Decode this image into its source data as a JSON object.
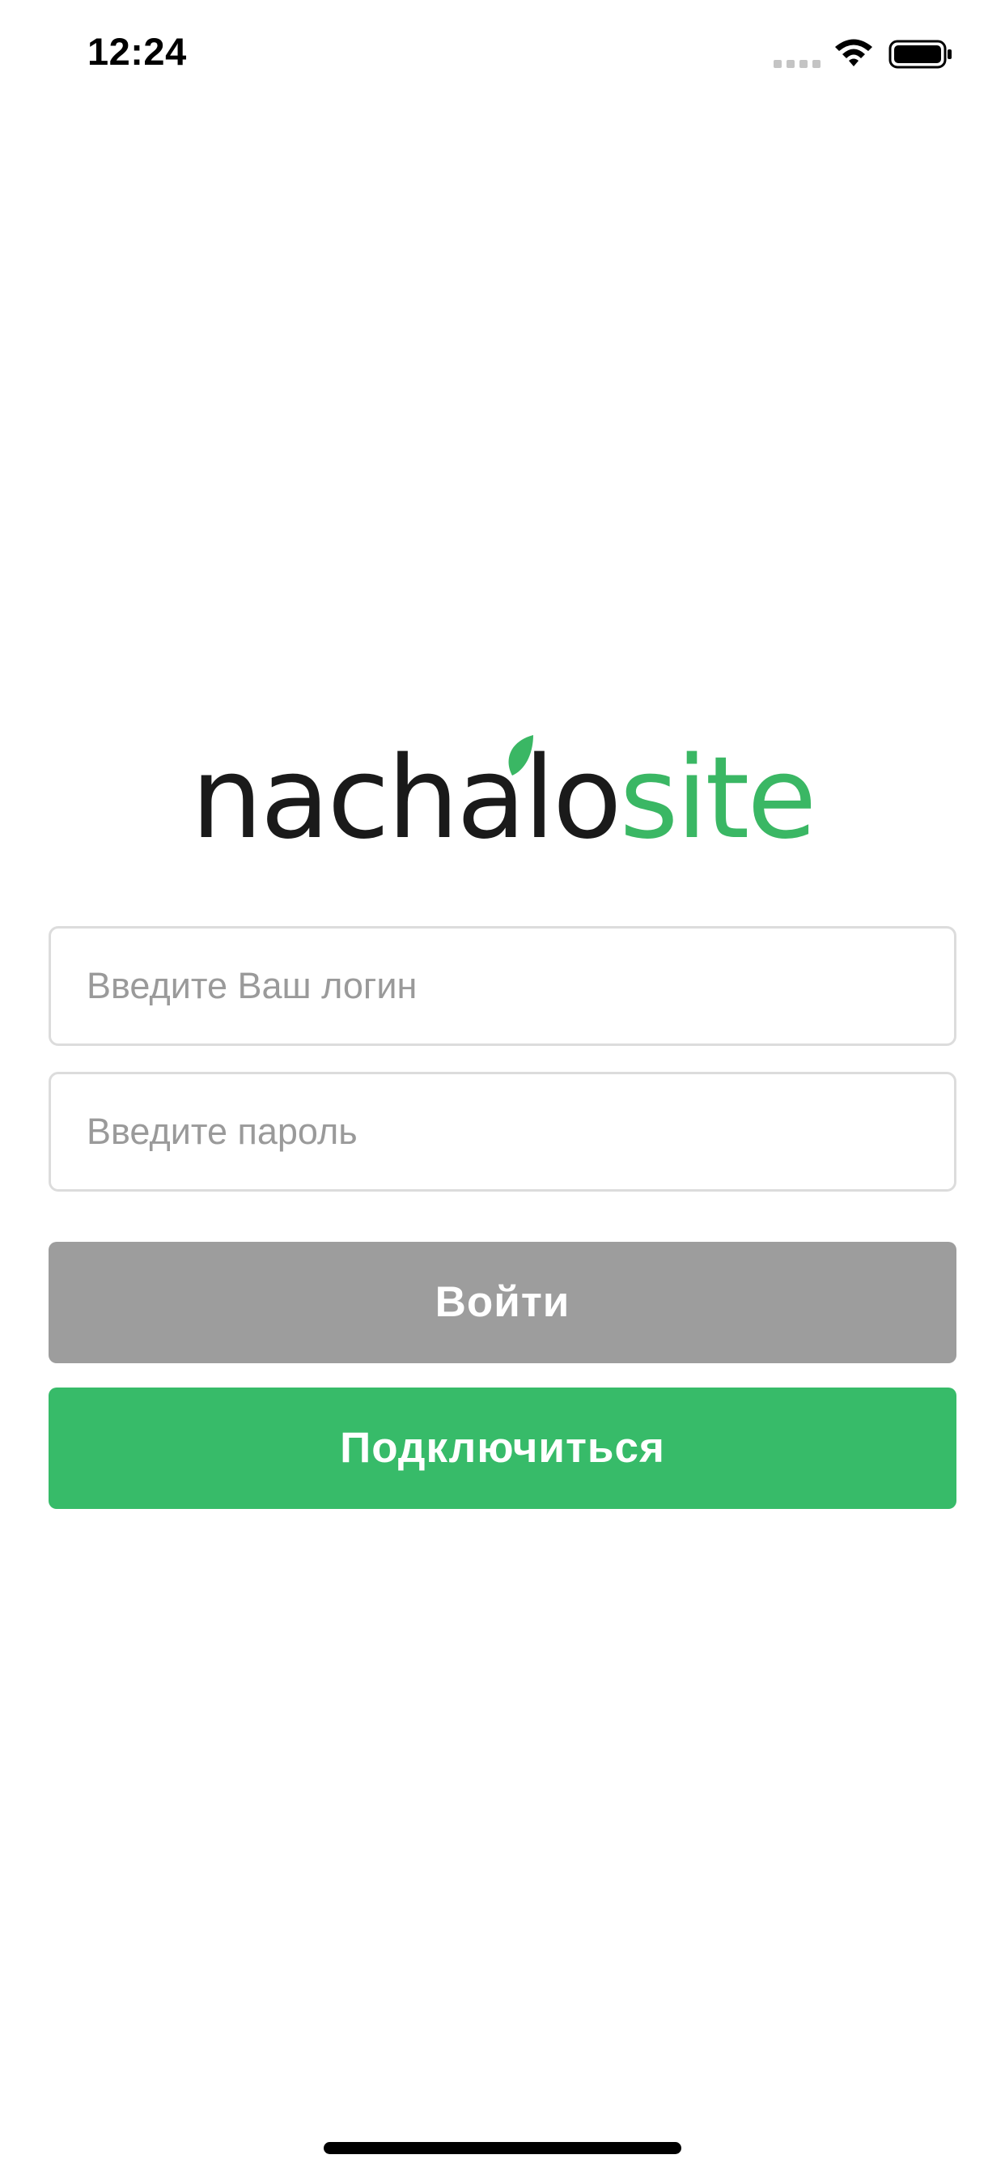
{
  "status_bar": {
    "time": "12:24",
    "icons": [
      "signal-icon",
      "wifi-icon",
      "battery-icon"
    ]
  },
  "logo": {
    "text_dark": "nachalo",
    "text_green": "site",
    "colors": {
      "dark": "#1a1a1a",
      "green": "#3ab764"
    }
  },
  "form": {
    "login_placeholder": "Введите Ваш логин",
    "login_value": "",
    "password_placeholder": "Введите пароль",
    "password_value": ""
  },
  "buttons": {
    "login_label": "Войти",
    "connect_label": "Подключиться"
  },
  "colors": {
    "login_button": "#9d9d9d",
    "connect_button": "#37bb69",
    "placeholder": "#9a9a9a",
    "field_border": "#dcdcdc"
  }
}
